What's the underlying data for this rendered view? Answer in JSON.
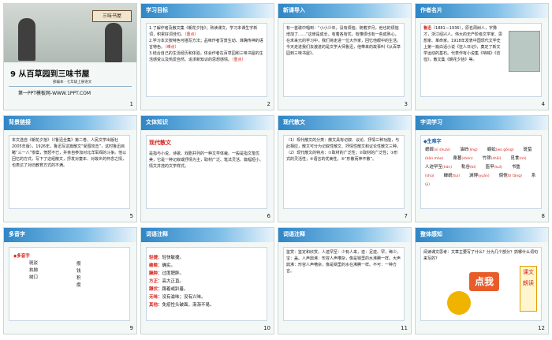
{
  "slides": [
    {
      "kind": "cover",
      "sign": "三味书屋",
      "title": "9  从百草园到三味书屋",
      "subtitle": "部编本 · 七年级上册语文",
      "site": "第一PPT模板网-WWW.1PPT.COM",
      "num": "1"
    },
    {
      "title": "学习目标",
      "text_a": "1.了解作者及散文集《朝花夕拾》；熟读课文，学习本课生字新词，积累好词佳句。",
      "text_b": "（重点）",
      "text_c": "2.学习本文按特色可描写方法；品味作者写景生动、准确传神的语言特色。",
      "text_d": "（难点）",
      "text_e": "3.结合自己的生活经历和体验，体会作者在百草园和三味书屋的生活感受以及热爱自然、追求新知识的思想感情。",
      "text_f": "（重点）",
      "num": "2"
    },
    {
      "title": "新课导入",
      "text": "有一首歌中唱到：“小小少年，没有烦恼，随着岁月，他也的烦恼增加了……”这使是成长，有着各有忧，有懂烦也有一些成熟心，在未来元的学习中，我们将走进一位大作家，回忆他眼中的生活。今天走进我们去渡进的是文学大师鲁迅，他带来的故事叫《从百草园到三味书屋》。",
      "num": "3"
    },
    {
      "title": "作者名片",
      "name": "鲁迅",
      "text": "（1881—1936），原名周树人，字豫才，浙江绍兴人。伟大的无产阶级文学家、思想家、革命家。1918年发表中国现代文学史上第一篇白话小说《狂人日记》，奠定了新文学运动的基石。代表作有小说集《呐喊》《彷徨》，散文集《朝花夕拾》等。",
      "num": "4"
    },
    {
      "title": "背景链接",
      "text": "本文选自《朝花夕拾》（《鲁迅全集》第二卷，人民文学出版社2005年版）。1926年，鲁迅写这篇散文“受围攻击”，这时鲁迅目睹“三一八”惨案，愤怒不已，并亲自参加对北洋军阀的斗争。他以回忆的方式，写下了这组散文，抒发对童年、对故乡的怀念之情，也表达了对旧教育方式的不满。",
      "num": "5"
    },
    {
      "title": "文体知识",
      "term": "现代散文",
      "text": "是指与小说、诗歌、戏剧并列的一种文学体裁。一般是指文笔优美，它是一种记叙或抒情为主，取材广泛、笔法灵活、篇幅短小、情文并茂的文学样式。",
      "num": "6"
    },
    {
      "title": "现代散文",
      "text": "（1）现代散文的分类：散文具有记叙、议论、抒情三种功能，与此相应，散文可分为记叙性散文、抒情性散文和议论性散文三种。（2）现代散文的特点：①取材的广泛性；②取材的广泛性；③形式的灵活性；④语言的优美性。⑤“形散而神不散”。",
      "num": "7"
    },
    {
      "title": "字词学习",
      "head": "◆生难字",
      "words": [
        "蟋蟀",
        "油蛉",
        "蜈蚣",
        "斑蝥",
        "桑葚",
        "竹筛",
        "觅食",
        "人迹罕至",
        "秕谷",
        "盔甲",
        "书塾",
        "蝉蜕",
        "渊博",
        "倜傥",
        "系"
      ],
      "pinyin": [
        "xī shuài",
        "líng",
        "wú gōng",
        "bān máo",
        "shèn",
        "shāi",
        "mì",
        "hǎn",
        "bǐ",
        "kuī",
        "shú",
        "tuì",
        "yuān",
        "tì tǎng",
        "jì"
      ],
      "num": "8"
    },
    {
      "title": "多音字",
      "left_head": "◆多音字",
      "left": [
        "斑驳",
        "执拗",
        "拗口"
      ],
      "right": [
        "攒钱",
        "积攒"
      ],
      "num": "9"
    },
    {
      "title": "词语注释",
      "items": [
        {
          "term": "轻捷：",
          "def": "轻快敏捷。"
        },
        {
          "term": "确凿：",
          "def": "确实。"
        },
        {
          "term": "臃肿：",
          "def": "过度肥胖。"
        },
        {
          "term": "方正：",
          "def": "高大正直。"
        },
        {
          "term": "蹲伏：",
          "def": "蹲着或趴着。"
        },
        {
          "term": "无味：",
          "def": "没有滋味；没有兴味。"
        },
        {
          "term": "其他：",
          "def": "免疫性头破面，渐渐不易。"
        }
      ],
      "num": "10"
    },
    {
      "title": "词语注释",
      "text": "鉴赏：鉴定和欣赏。人迹罕至：少有人来，迹：足迹。罕，稀少。宝：盖。人声鼎沸：形容人声嘈杂，像是锅里的水沸腾一样。大声鼎沸：形容人声嘈杂，像是锅里的水在沸腾一样。不可：一种方言。",
      "num": "11"
    },
    {
      "title": "整体感知",
      "text": "阅读课文思考：文章主要写了什么？分为几个部分？抓哪什么词句来写的？",
      "dian": "点我",
      "stamp": "课文朗读",
      "num": "12"
    }
  ]
}
